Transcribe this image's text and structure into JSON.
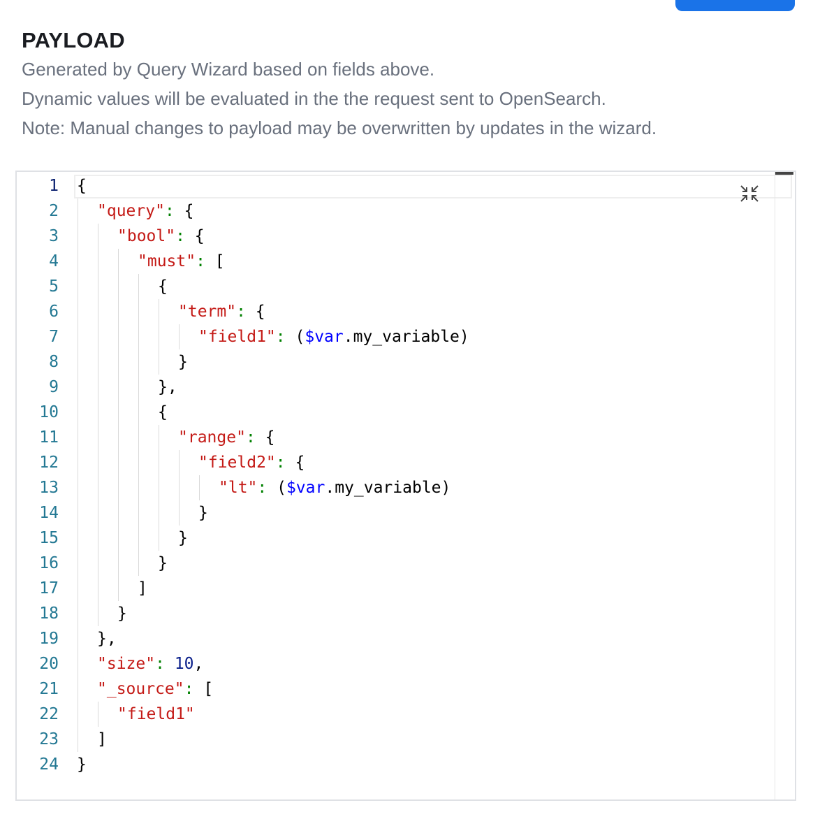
{
  "header": {
    "title": "PAYLOAD",
    "desc1": "Generated by Query Wizard based on fields above.",
    "desc2": "Dynamic values will be evaluated in the the request sent to OpenSearch.",
    "desc3": "Note: Manual changes to payload may be overwritten by updates in the wizard."
  },
  "editor": {
    "fold_icon": "collapse-icon",
    "colors": {
      "key": "#c41a16",
      "number": "#0a1f8a",
      "variable": "#0000ff",
      "line_number": "#237893",
      "colon": "#008000"
    },
    "lines": [
      {
        "num": "1",
        "indent": 0,
        "segs": [
          {
            "t": "{",
            "c": "p"
          }
        ]
      },
      {
        "num": "2",
        "indent": 1,
        "segs": [
          {
            "t": "\"query\"",
            "c": "k"
          },
          {
            "t": ":",
            "c": "c"
          },
          {
            "t": " {",
            "c": "p"
          }
        ]
      },
      {
        "num": "3",
        "indent": 2,
        "segs": [
          {
            "t": "\"bool\"",
            "c": "k"
          },
          {
            "t": ":",
            "c": "c"
          },
          {
            "t": " {",
            "c": "p"
          }
        ]
      },
      {
        "num": "4",
        "indent": 3,
        "segs": [
          {
            "t": "\"must\"",
            "c": "k"
          },
          {
            "t": ":",
            "c": "c"
          },
          {
            "t": " [",
            "c": "p"
          }
        ]
      },
      {
        "num": "5",
        "indent": 4,
        "segs": [
          {
            "t": "{",
            "c": "p"
          }
        ]
      },
      {
        "num": "6",
        "indent": 5,
        "segs": [
          {
            "t": "\"term\"",
            "c": "k"
          },
          {
            "t": ":",
            "c": "c"
          },
          {
            "t": " {",
            "c": "p"
          }
        ]
      },
      {
        "num": "7",
        "indent": 6,
        "segs": [
          {
            "t": "\"field1\"",
            "c": "k"
          },
          {
            "t": ":",
            "c": "c"
          },
          {
            "t": " (",
            "c": "p"
          },
          {
            "t": "$var",
            "c": "v"
          },
          {
            "t": ".my_variable)",
            "c": "p"
          }
        ]
      },
      {
        "num": "8",
        "indent": 5,
        "segs": [
          {
            "t": "}",
            "c": "p"
          }
        ]
      },
      {
        "num": "9",
        "indent": 4,
        "segs": [
          {
            "t": "},",
            "c": "p"
          }
        ]
      },
      {
        "num": "10",
        "indent": 4,
        "segs": [
          {
            "t": "{",
            "c": "p"
          }
        ]
      },
      {
        "num": "11",
        "indent": 5,
        "segs": [
          {
            "t": "\"range\"",
            "c": "k"
          },
          {
            "t": ":",
            "c": "c"
          },
          {
            "t": " {",
            "c": "p"
          }
        ]
      },
      {
        "num": "12",
        "indent": 6,
        "segs": [
          {
            "t": "\"field2\"",
            "c": "k"
          },
          {
            "t": ":",
            "c": "c"
          },
          {
            "t": " {",
            "c": "p"
          }
        ]
      },
      {
        "num": "13",
        "indent": 7,
        "segs": [
          {
            "t": "\"lt\"",
            "c": "k"
          },
          {
            "t": ":",
            "c": "c"
          },
          {
            "t": " (",
            "c": "p"
          },
          {
            "t": "$var",
            "c": "v"
          },
          {
            "t": ".my_variable)",
            "c": "p"
          }
        ]
      },
      {
        "num": "14",
        "indent": 6,
        "segs": [
          {
            "t": "}",
            "c": "p"
          }
        ]
      },
      {
        "num": "15",
        "indent": 5,
        "segs": [
          {
            "t": "}",
            "c": "p"
          }
        ]
      },
      {
        "num": "16",
        "indent": 4,
        "segs": [
          {
            "t": "}",
            "c": "p"
          }
        ]
      },
      {
        "num": "17",
        "indent": 3,
        "segs": [
          {
            "t": "]",
            "c": "p"
          }
        ]
      },
      {
        "num": "18",
        "indent": 2,
        "segs": [
          {
            "t": "}",
            "c": "p"
          }
        ]
      },
      {
        "num": "19",
        "indent": 1,
        "segs": [
          {
            "t": "},",
            "c": "p"
          }
        ]
      },
      {
        "num": "20",
        "indent": 1,
        "segs": [
          {
            "t": "\"size\"",
            "c": "k"
          },
          {
            "t": ":",
            "c": "c"
          },
          {
            "t": " ",
            "c": "p"
          },
          {
            "t": "10",
            "c": "n"
          },
          {
            "t": ",",
            "c": "p"
          }
        ]
      },
      {
        "num": "21",
        "indent": 1,
        "segs": [
          {
            "t": "\"_source\"",
            "c": "k"
          },
          {
            "t": ":",
            "c": "c"
          },
          {
            "t": " [",
            "c": "p"
          }
        ]
      },
      {
        "num": "22",
        "indent": 2,
        "segs": [
          {
            "t": "\"field1\"",
            "c": "k"
          }
        ]
      },
      {
        "num": "23",
        "indent": 1,
        "segs": [
          {
            "t": "]",
            "c": "p"
          }
        ]
      },
      {
        "num": "24",
        "indent": 0,
        "segs": [
          {
            "t": "}",
            "c": "p"
          }
        ]
      }
    ]
  }
}
